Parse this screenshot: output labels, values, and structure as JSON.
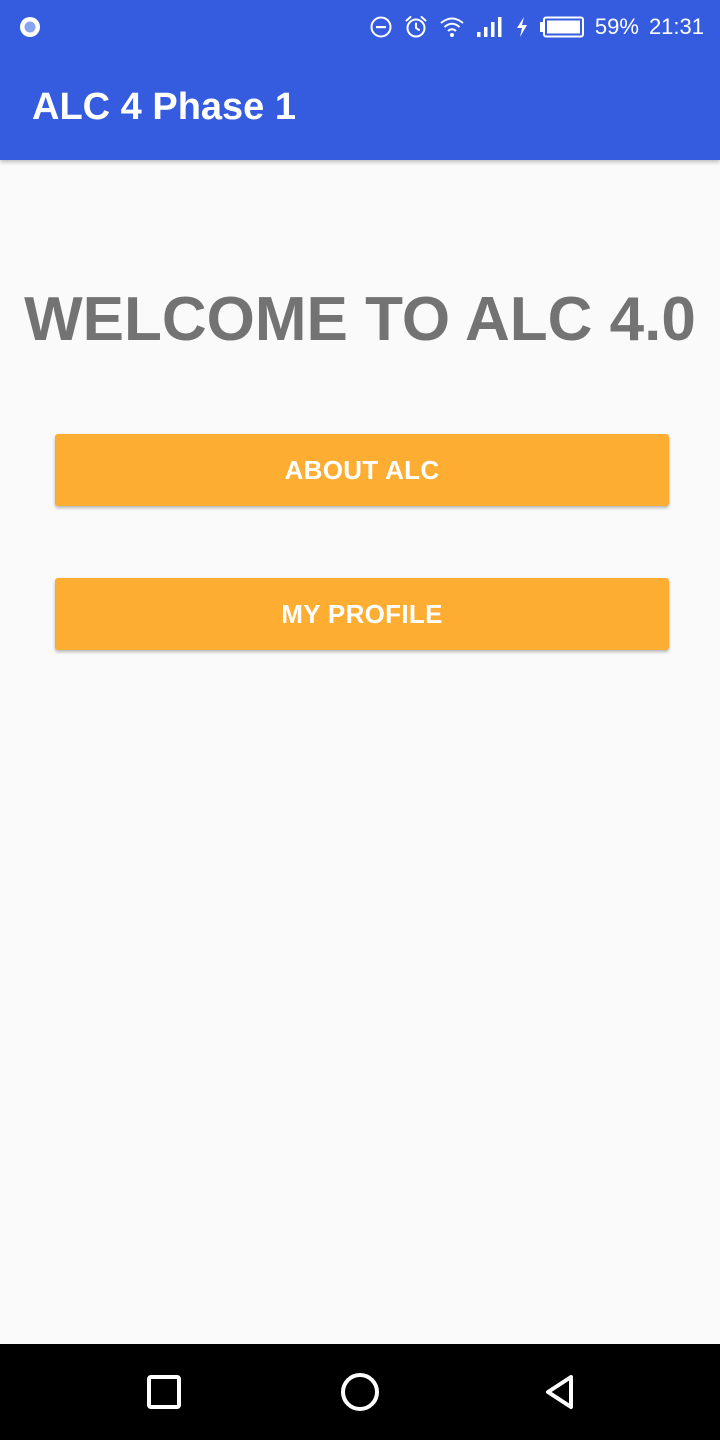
{
  "status_bar": {
    "battery_percent": "59%",
    "time": "21:31",
    "icons": [
      "app-notification-icon",
      "do-not-disturb-icon",
      "alarm-icon",
      "wifi-icon",
      "cell-signal-icon",
      "charging-icon",
      "battery-icon"
    ]
  },
  "app_bar": {
    "title": "ALC 4 Phase 1",
    "color": "#355cde"
  },
  "main": {
    "welcome_text": "WELCOME TO ALC 4.0",
    "buttons": {
      "about_label": "ABOUT ALC",
      "profile_label": "MY PROFILE"
    },
    "button_color": "#fdad31"
  },
  "nav_bar": {
    "icons": [
      "recent-apps-icon",
      "home-icon",
      "back-icon"
    ]
  }
}
